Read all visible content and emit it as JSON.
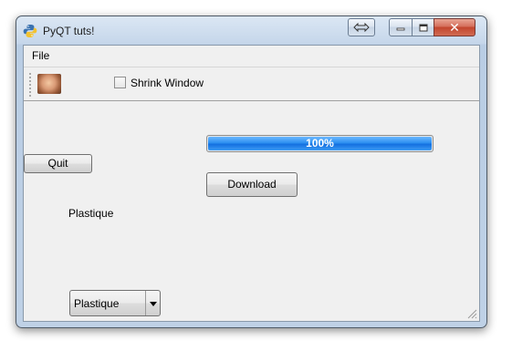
{
  "window": {
    "title": "PyQT tuts!",
    "icon": "python-icon",
    "caption_buttons": {
      "helper": "resize-arrows-icon",
      "minimize": "minimize-icon",
      "maximize": "maximize-icon",
      "close": "close-icon",
      "close_glyph": "✕"
    }
  },
  "menubar": {
    "items": [
      {
        "label": "File"
      }
    ]
  },
  "toolbar": {
    "image_action": "face-thumbnail-icon",
    "checkbox": {
      "label": "Shrink Window",
      "checked": false
    }
  },
  "main": {
    "progress": {
      "value": 100,
      "text": "100%"
    },
    "quit_label": "Quit",
    "download_label": "Download",
    "style_label": "Plastique",
    "style_combo": {
      "selected": "Plastique"
    }
  },
  "colors": {
    "progress_fill": "#1470e0",
    "window_frame": "#b9cde4",
    "close_button": "#c2452e"
  }
}
